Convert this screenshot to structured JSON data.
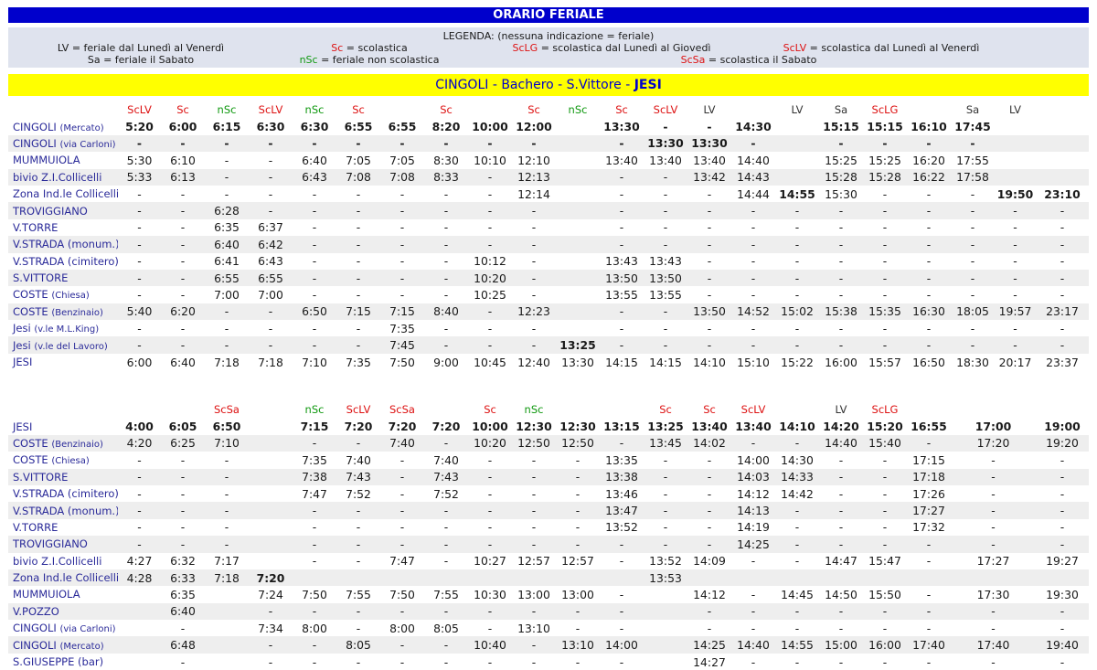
{
  "title": "ORARIO FERIALE",
  "legend": {
    "heading": "LEGENDA: (nessuna indicazione = feriale)",
    "lv": "LV = feriale dal Lunedì al Venerdì",
    "sa": "Sa = feriale il Sabato",
    "sc": "Sc = scolastica",
    "nsc": "nSc = feriale non scolastica",
    "sclg": "ScLG = scolastica dal Lunedì al Giovedì",
    "scsa": "ScSa = scolastica il Sabato",
    "sclv": "ScLV = scolastica dal Lunedì al Venerdì"
  },
  "route": {
    "part1": "CINGOLI - Bachero - S.Vittore - ",
    "part2": "JESI"
  },
  "colors": {
    "title_bg": "#0000cc",
    "legend_bg": "#dfe3ee",
    "route_bg": "#ffff00",
    "route_text": "#0000cc",
    "red": "#dd1111",
    "green": "#119911",
    "stop_text": "#2a2a99"
  },
  "table_out": {
    "header": [
      "",
      "ScLV",
      "Sc",
      "nSc",
      "ScLV",
      "nSc",
      "Sc",
      "",
      "Sc",
      "",
      "Sc",
      "nSc",
      "Sc",
      "ScLV",
      "LV",
      "",
      "LV",
      "Sa",
      "ScLG",
      "",
      "Sa",
      "LV"
    ],
    "rows": [
      {
        "stop": "CINGOLI",
        "sub": "(Mercato)",
        "bold": true,
        "cells": [
          "5:20",
          "6:00",
          "6:15",
          "6:30",
          "6:30",
          "6:55",
          "6:55",
          "8:20",
          "10:00",
          "12:00",
          "",
          "13:30",
          "-",
          "-",
          "14:30",
          "",
          "15:15",
          "15:15",
          "16:10",
          "17:45",
          "",
          ""
        ]
      },
      {
        "stop": "CINGOLI",
        "sub": "(via Carloni)",
        "bold": true,
        "cells": [
          "-",
          "-",
          "-",
          "-",
          "-",
          "-",
          "-",
          "-",
          "-",
          "-",
          "",
          "-",
          "13:30",
          "13:30",
          "-",
          "",
          "-",
          "-",
          "-",
          "-",
          "",
          ""
        ]
      },
      {
        "stop": "MUMMUIOLA",
        "sub": "",
        "cells": [
          "5:30",
          "6:10",
          "-",
          "-",
          "6:40",
          "7:05",
          "7:05",
          "8:30",
          "10:10",
          "12:10",
          "",
          "13:40",
          "13:40",
          "13:40",
          "14:40",
          "",
          "15:25",
          "15:25",
          "16:20",
          "17:55",
          "",
          ""
        ]
      },
      {
        "stop": "bivio Z.I.Collicelli",
        "sub": "",
        "cells": [
          "5:33",
          "6:13",
          "-",
          "-",
          "6:43",
          "7:08",
          "7:08",
          "8:33",
          "-",
          "12:13",
          "",
          "-",
          "-",
          "13:42",
          "14:43",
          "",
          "15:28",
          "15:28",
          "16:22",
          "17:58",
          "",
          ""
        ]
      },
      {
        "stop": "Zona Ind.le Collicelli",
        "sub": "",
        "boldcols": [
          15,
          20,
          21
        ],
        "cells": [
          "-",
          "-",
          "-",
          "-",
          "-",
          "-",
          "-",
          "-",
          "-",
          "12:14",
          "",
          "-",
          "-",
          "-",
          "14:44",
          "14:55",
          "15:30",
          "-",
          "-",
          "-",
          "19:50",
          "23:10"
        ]
      },
      {
        "stop": "TROVIGGIANO",
        "sub": "",
        "cells": [
          "-",
          "-",
          "6:28",
          "-",
          "-",
          "-",
          "-",
          "-",
          "-",
          "-",
          "",
          "-",
          "-",
          "-",
          "-",
          "-",
          "-",
          "-",
          "-",
          "-",
          "-",
          "-"
        ]
      },
      {
        "stop": "V.TORRE",
        "sub": "",
        "cells": [
          "-",
          "-",
          "6:35",
          "6:37",
          "-",
          "-",
          "-",
          "-",
          "-",
          "-",
          "",
          "-",
          "-",
          "-",
          "-",
          "-",
          "-",
          "-",
          "-",
          "-",
          "-",
          "-"
        ]
      },
      {
        "stop": "V.STRADA (monum.)",
        "sub": "",
        "cells": [
          "-",
          "-",
          "6:40",
          "6:42",
          "-",
          "-",
          "-",
          "-",
          "-",
          "-",
          "",
          "-",
          "-",
          "-",
          "-",
          "-",
          "-",
          "-",
          "-",
          "-",
          "-",
          "-"
        ]
      },
      {
        "stop": "V.STRADA (cimitero)",
        "sub": "",
        "cells": [
          "-",
          "-",
          "6:41",
          "6:43",
          "-",
          "-",
          "-",
          "-",
          "10:12",
          "-",
          "",
          "13:43",
          "13:43",
          "-",
          "-",
          "-",
          "-",
          "-",
          "-",
          "-",
          "-",
          "-"
        ]
      },
      {
        "stop": "S.VITTORE",
        "sub": "",
        "cells": [
          "-",
          "-",
          "6:55",
          "6:55",
          "-",
          "-",
          "-",
          "-",
          "10:20",
          "-",
          "",
          "13:50",
          "13:50",
          "-",
          "-",
          "-",
          "-",
          "-",
          "-",
          "-",
          "-",
          "-"
        ]
      },
      {
        "stop": "COSTE",
        "sub": "(Chiesa)",
        "cells": [
          "-",
          "-",
          "7:00",
          "7:00",
          "-",
          "-",
          "-",
          "-",
          "10:25",
          "-",
          "",
          "13:55",
          "13:55",
          "-",
          "-",
          "-",
          "-",
          "-",
          "-",
          "-",
          "-",
          "-"
        ]
      },
      {
        "stop": "COSTE",
        "sub": "(Benzinaio)",
        "cells": [
          "5:40",
          "6:20",
          "-",
          "-",
          "6:50",
          "7:15",
          "7:15",
          "8:40",
          "-",
          "12:23",
          "",
          "-",
          "-",
          "13:50",
          "14:52",
          "15:02",
          "15:38",
          "15:35",
          "16:30",
          "18:05",
          "19:57",
          "23:17"
        ]
      },
      {
        "stop": "Jesi",
        "sub": "(v.le M.L.King)",
        "cells": [
          "-",
          "-",
          "-",
          "-",
          "-",
          "-",
          "7:35",
          "-",
          "-",
          "-",
          "",
          "-",
          "-",
          "-",
          "-",
          "-",
          "-",
          "-",
          "-",
          "-",
          "-",
          "-"
        ]
      },
      {
        "stop": "Jesi",
        "sub": "(v.le del Lavoro)",
        "boldcols": [
          10
        ],
        "cells": [
          "-",
          "-",
          "-",
          "-",
          "-",
          "-",
          "7:45",
          "-",
          "-",
          "-",
          "13:25",
          "-",
          "-",
          "-",
          "-",
          "-",
          "-",
          "-",
          "-",
          "-",
          "-",
          "-"
        ]
      },
      {
        "stop": "JESI",
        "sub": "",
        "cells": [
          "6:00",
          "6:40",
          "7:18",
          "7:18",
          "7:10",
          "7:35",
          "7:50",
          "9:00",
          "10:45",
          "12:40",
          "13:30",
          "14:15",
          "14:15",
          "14:10",
          "15:10",
          "15:22",
          "16:00",
          "15:57",
          "16:50",
          "18:30",
          "20:17",
          "23:37"
        ]
      }
    ]
  },
  "table_ret": {
    "header": [
      "",
      "",
      "",
      "ScSa",
      "",
      "nSc",
      "ScLV",
      "ScSa",
      "",
      "Sc",
      "nSc",
      "",
      "",
      "Sc",
      "Sc",
      "ScLV",
      "",
      "LV",
      "ScLG",
      "",
      ""
    ],
    "rows": [
      {
        "stop": "JESI",
        "sub": "",
        "bold": true,
        "cells": [
          "4:00",
          "6:05",
          "6:50",
          "",
          "7:15",
          "7:20",
          "7:20",
          "7:20",
          "10:00",
          "12:30",
          "12:30",
          "13:15",
          "13:25",
          "13:40",
          "13:40",
          "14:10",
          "14:20",
          "15:20",
          "16:55",
          "17:00",
          "19:00"
        ]
      },
      {
        "stop": "COSTE",
        "sub": "(Benzinaio)",
        "cells": [
          "4:20",
          "6:25",
          "7:10",
          "",
          "-",
          "-",
          "7:40",
          "-",
          "10:20",
          "12:50",
          "12:50",
          "-",
          "13:45",
          "14:02",
          "-",
          "-",
          "14:40",
          "15:40",
          "-",
          "17:20",
          "19:20"
        ]
      },
      {
        "stop": "COSTE",
        "sub": "(Chiesa)",
        "cells": [
          "-",
          "-",
          "-",
          "",
          "7:35",
          "7:40",
          "-",
          "7:40",
          "-",
          "-",
          "-",
          "13:35",
          "-",
          "-",
          "14:00",
          "14:30",
          "-",
          "-",
          "17:15",
          "-",
          "-"
        ]
      },
      {
        "stop": "S.VITTORE",
        "sub": "",
        "cells": [
          "-",
          "-",
          "-",
          "",
          "7:38",
          "7:43",
          "-",
          "7:43",
          "-",
          "-",
          "-",
          "13:38",
          "-",
          "-",
          "14:03",
          "14:33",
          "-",
          "-",
          "17:18",
          "-",
          "-"
        ]
      },
      {
        "stop": "V.STRADA (cimitero)",
        "sub": "",
        "cells": [
          "-",
          "-",
          "-",
          "",
          "7:47",
          "7:52",
          "-",
          "7:52",
          "-",
          "-",
          "-",
          "13:46",
          "-",
          "-",
          "14:12",
          "14:42",
          "-",
          "-",
          "17:26",
          "-",
          "-"
        ]
      },
      {
        "stop": "V.STRADA (monum.)",
        "sub": "",
        "cells": [
          "-",
          "-",
          "-",
          "",
          "-",
          "-",
          "-",
          "-",
          "-",
          "-",
          "-",
          "13:47",
          "-",
          "-",
          "14:13",
          "-",
          "-",
          "-",
          "17:27",
          "-",
          "-"
        ]
      },
      {
        "stop": "V.TORRE",
        "sub": "",
        "cells": [
          "-",
          "-",
          "-",
          "",
          "-",
          "-",
          "-",
          "-",
          "-",
          "-",
          "-",
          "13:52",
          "-",
          "-",
          "14:19",
          "-",
          "-",
          "-",
          "17:32",
          "-",
          "-"
        ]
      },
      {
        "stop": "TROVIGGIANO",
        "sub": "",
        "cells": [
          "-",
          "-",
          "-",
          "",
          "-",
          "-",
          "-",
          "-",
          "-",
          "-",
          "-",
          "-",
          "-",
          "-",
          "14:25",
          "-",
          "-",
          "-",
          "-",
          "-",
          "-"
        ]
      },
      {
        "stop": "bivio Z.I.Collicelli",
        "sub": "",
        "cells": [
          "4:27",
          "6:32",
          "7:17",
          "",
          "-",
          "-",
          "7:47",
          "-",
          "10:27",
          "12:57",
          "12:57",
          "-",
          "13:52",
          "14:09",
          "-",
          "-",
          "14:47",
          "15:47",
          "-",
          "17:27",
          "19:27"
        ]
      },
      {
        "stop": "Zona Ind.le Collicelli",
        "sub": "",
        "boldcols": [
          3
        ],
        "cells": [
          "4:28",
          "6:33",
          "7:18",
          "7:20",
          "",
          "",
          "",
          "",
          "",
          "",
          "",
          "",
          "13:53",
          "",
          "",
          "",
          "",
          "",
          "",
          "",
          ""
        ]
      },
      {
        "stop": "MUMMUIOLA",
        "sub": "",
        "cells": [
          "",
          "6:35",
          "",
          "7:24",
          "7:50",
          "7:55",
          "7:50",
          "7:55",
          "10:30",
          "13:00",
          "13:00",
          "-",
          "",
          "14:12",
          "-",
          "14:45",
          "14:50",
          "15:50",
          "-",
          "17:30",
          "19:30"
        ]
      },
      {
        "stop": "V.POZZO",
        "sub": "",
        "cells": [
          "",
          "6:40",
          "",
          "-",
          "-",
          "-",
          "-",
          "-",
          "-",
          "-",
          "-",
          "-",
          "",
          "-",
          "-",
          "-",
          "-",
          "-",
          "-",
          "-",
          "-"
        ]
      },
      {
        "stop": "CINGOLI",
        "sub": "(via Carloni)",
        "cells": [
          "",
          "-",
          "",
          "7:34",
          "8:00",
          "-",
          "8:00",
          "8:05",
          "-",
          "13:10",
          "-",
          "-",
          "",
          "-",
          "-",
          "-",
          "-",
          "-",
          "-",
          "-",
          "-"
        ]
      },
      {
        "stop": "CINGOLI",
        "sub": "(Mercato)",
        "cells": [
          "",
          "6:48",
          "",
          "-",
          "-",
          "8:05",
          "-",
          "-",
          "10:40",
          "-",
          "13:10",
          "14:00",
          "",
          "14:25",
          "14:40",
          "14:55",
          "15:00",
          "16:00",
          "17:40",
          "17:40",
          "19:40"
        ]
      },
      {
        "stop": "S.GIUSEPPE (bar)",
        "sub": "",
        "cells": [
          "",
          "-",
          "",
          "-",
          "-",
          "-",
          "-",
          "-",
          "-",
          "-",
          "-",
          "-",
          "",
          "14:27",
          "-",
          "-",
          "-",
          "-",
          "-",
          "-",
          "-"
        ]
      }
    ]
  }
}
